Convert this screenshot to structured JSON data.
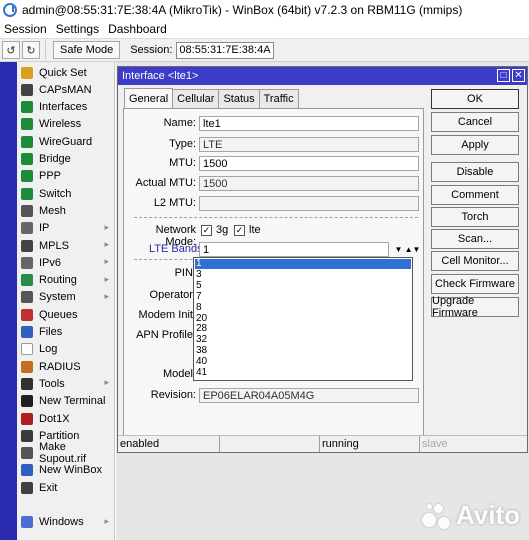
{
  "window": {
    "title": "admin@08:55:31:7E:38:4A (MikroTik) - WinBox (64bit) v7.2.3 on RBM11G (mmips)"
  },
  "menubar": {
    "items": [
      "Session",
      "Settings",
      "Dashboard"
    ]
  },
  "toolbar": {
    "undo_icon": "undo-icon",
    "redo_icon": "redo-icon",
    "safe_mode_label": "Safe Mode",
    "session_label": "Session:",
    "session_value": "08:55:31:7E:38:4A"
  },
  "sidebar": {
    "items": [
      {
        "label": "Quick Set",
        "icon": "quick-set-icon",
        "color": "#d9a020",
        "arrow": false
      },
      {
        "label": "CAPsMAN",
        "icon": "capsman-icon",
        "color": "#444444",
        "arrow": false
      },
      {
        "label": "Interfaces",
        "icon": "interfaces-icon",
        "color": "#1f8a3a",
        "arrow": false
      },
      {
        "label": "Wireless",
        "icon": "wireless-icon",
        "color": "#1f8a3a",
        "arrow": false
      },
      {
        "label": "WireGuard",
        "icon": "wireguard-icon",
        "color": "#1f8a3a",
        "arrow": false
      },
      {
        "label": "Bridge",
        "icon": "bridge-icon",
        "color": "#1f8a3a",
        "arrow": false
      },
      {
        "label": "PPP",
        "icon": "ppp-icon",
        "color": "#1f8a3a",
        "arrow": false
      },
      {
        "label": "Switch",
        "icon": "switch-icon",
        "color": "#1f8a3a",
        "arrow": false
      },
      {
        "label": "Mesh",
        "icon": "mesh-icon",
        "color": "#555555",
        "arrow": false
      },
      {
        "label": "IP",
        "icon": "ip-icon",
        "color": "#666666",
        "arrow": true
      },
      {
        "label": "MPLS",
        "icon": "mpls-icon",
        "color": "#444444",
        "arrow": true
      },
      {
        "label": "IPv6",
        "icon": "ipv6-icon",
        "color": "#666666",
        "arrow": true
      },
      {
        "label": "Routing",
        "icon": "routing-icon",
        "color": "#2a8a4a",
        "arrow": true
      },
      {
        "label": "System",
        "icon": "system-icon",
        "color": "#555555",
        "arrow": true
      },
      {
        "label": "Queues",
        "icon": "queues-icon",
        "color": "#c03030",
        "arrow": false
      },
      {
        "label": "Files",
        "icon": "files-icon",
        "color": "#3060c0",
        "arrow": false
      },
      {
        "label": "Log",
        "icon": "log-icon",
        "color": "#ffffff",
        "arrow": false
      },
      {
        "label": "RADIUS",
        "icon": "radius-icon",
        "color": "#c07020",
        "arrow": false
      },
      {
        "label": "Tools",
        "icon": "tools-icon",
        "color": "#303030",
        "arrow": true
      },
      {
        "label": "New Terminal",
        "icon": "terminal-icon",
        "color": "#202020",
        "arrow": false
      },
      {
        "label": "Dot1X",
        "icon": "dot1x-icon",
        "color": "#b02020",
        "arrow": false
      },
      {
        "label": "Partition",
        "icon": "partition-icon",
        "color": "#3a3a3a",
        "arrow": false
      },
      {
        "label": "Make Supout.rif",
        "icon": "supout-icon",
        "color": "#555555",
        "arrow": false
      },
      {
        "label": "New WinBox",
        "icon": "winbox-icon",
        "color": "#3060c0",
        "arrow": false
      },
      {
        "label": "Exit",
        "icon": "exit-icon",
        "color": "#404040",
        "arrow": false
      }
    ],
    "windows_label": "Windows"
  },
  "dialog": {
    "title": "Interface <lte1>",
    "tabs": [
      "General",
      "Cellular",
      "Status",
      "Traffic"
    ],
    "active_tab": "General",
    "fields": {
      "name_label": "Name:",
      "name_value": "lte1",
      "type_label": "Type:",
      "type_value": "LTE",
      "mtu_label": "MTU:",
      "mtu_value": "1500",
      "actual_mtu_label": "Actual MTU:",
      "actual_mtu_value": "1500",
      "l2mtu_label": "L2 MTU:",
      "l2mtu_value": ""
    },
    "network_mode": {
      "label": "Network Mode:",
      "options": [
        {
          "label": "3g",
          "checked": true
        },
        {
          "label": "lte",
          "checked": true
        }
      ]
    },
    "lte_bands": {
      "label": "LTE Bands:",
      "value": "1",
      "options": [
        "1",
        "3",
        "5",
        "7",
        "8",
        "20",
        "28",
        "32",
        "38",
        "40",
        "41"
      ],
      "selected": "1"
    },
    "hidden_labels": {
      "pin": "PIN:",
      "operator": "Operator:",
      "modem_init": "Modem Init:",
      "apn_profile": "APN Profile:",
      "model": "Model:"
    },
    "revision": {
      "label": "Revision:",
      "value": "EP06ELAR04A05M4G"
    },
    "status_bar": [
      "enabled",
      "",
      "running",
      "slave"
    ],
    "buttons": [
      "OK",
      "Cancel",
      "Apply",
      "Disable",
      "Comment",
      "Torch",
      "Scan...",
      "Cell Monitor...",
      "Check Firmware",
      "Upgrade Firmware"
    ]
  },
  "watermark": {
    "text": "Avito"
  }
}
